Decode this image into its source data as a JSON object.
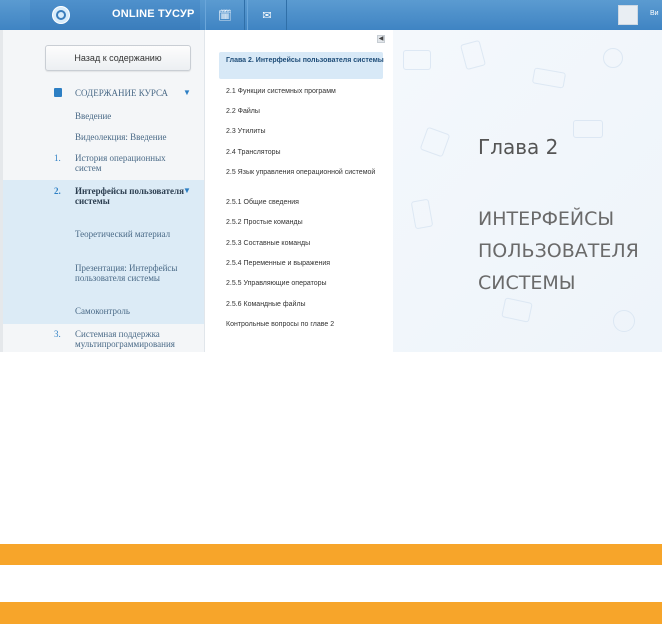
{
  "header": {
    "brand": "ONLINE ТУСУР",
    "calendar_icon": "calendar-icon",
    "mail_icon": "mail-icon",
    "user_name": "Ви"
  },
  "sidebar": {
    "back_button": "Назад к содержанию",
    "contents_label": "СОДЕРЖАНИЕ КУРСА",
    "items": [
      {
        "num": "",
        "label": "Введение"
      },
      {
        "num": "",
        "label": "Видеолекция: Введение"
      },
      {
        "num": "1.",
        "label": "История операционных систем"
      },
      {
        "num": "2.",
        "label": "Интерфейсы пользователя системы"
      },
      {
        "num": "",
        "label": "Теоретический материал"
      },
      {
        "num": "",
        "label": "Презентация: Интерфейсы пользователя системы"
      },
      {
        "num": "",
        "label": "Самоконтроль"
      },
      {
        "num": "3.",
        "label": "Системная поддержка мультипрограммирования"
      }
    ]
  },
  "toc": {
    "items": [
      "Глава 2. Интерфейсы пользователя системы",
      "2.1 Функции системных программ",
      "2.2 Файлы",
      "2.3 Утилиты",
      "2.4 Трансляторы",
      "2.5 Язык управления операционной системой",
      "2.5.1 Общие сведения",
      "2.5.2 Простые команды",
      "2.5.3 Составные команды",
      "2.5.4 Переменные и выражения",
      "2.5.5 Управляющие операторы",
      "2.5.6 Командные файлы",
      "Контрольные вопросы по главе 2"
    ]
  },
  "slide": {
    "title": "Глава 2",
    "subtitle": "ИНТЕРФЕЙСЫ ПОЛЬЗОВАТЕЛЯ СИСТЕМЫ"
  },
  "colors": {
    "accent": "#3f84c3",
    "band": "#f7a52a"
  }
}
